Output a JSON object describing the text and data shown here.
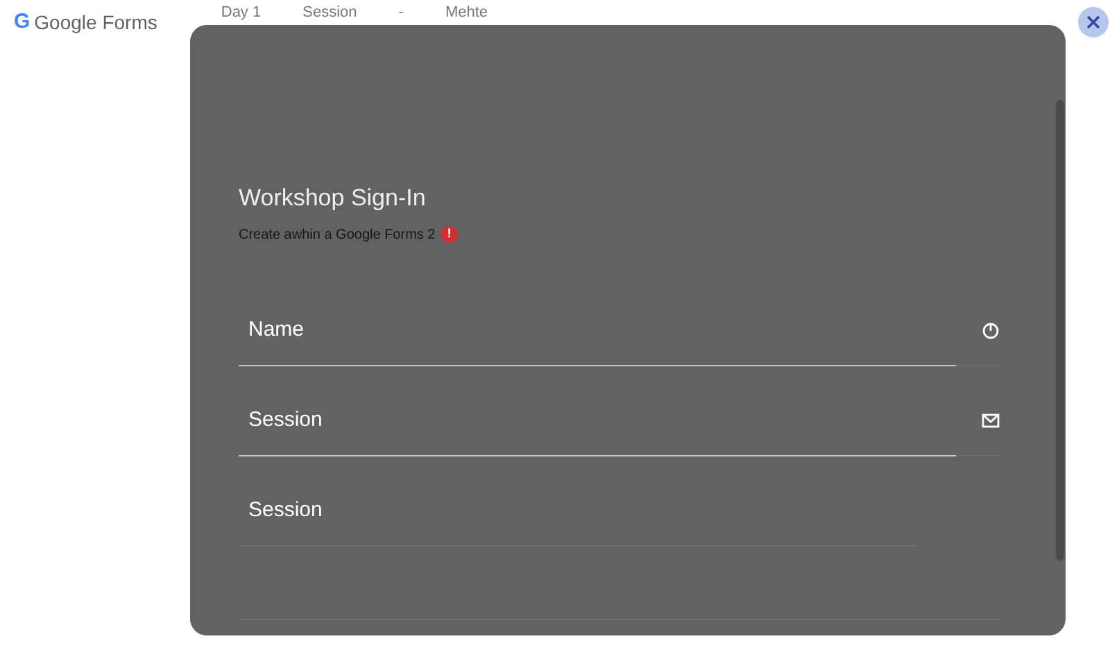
{
  "header": {
    "logo_mark": "G",
    "logo_text": "Google Forms",
    "tabs": [
      {
        "label": "Day 1"
      },
      {
        "label": "Session"
      },
      {
        "label": "-"
      },
      {
        "label": "Mehte"
      }
    ]
  },
  "dialog": {
    "title": "Workshop Sign-In",
    "subtitle": "Create awhin a Google Forms 2",
    "badge": "!",
    "fields": [
      {
        "label": "Name",
        "kind": "power"
      },
      {
        "label": "Session",
        "kind": "mail"
      },
      {
        "label": "Session",
        "kind": "plain"
      }
    ]
  }
}
